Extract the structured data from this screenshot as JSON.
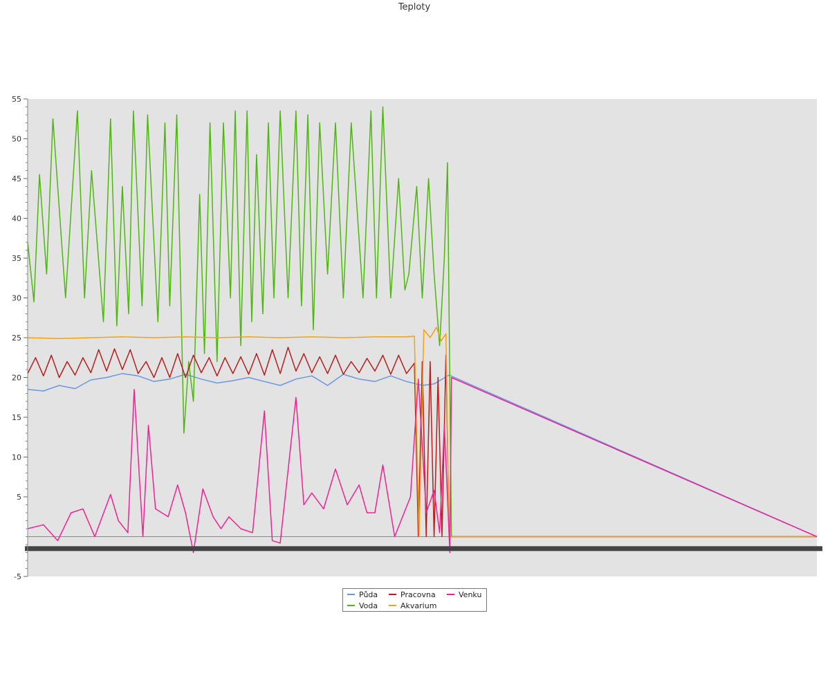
{
  "chart_data": {
    "type": "line",
    "title": "Teploty",
    "xlabel": "",
    "ylabel": "",
    "ylim": [
      -5,
      55
    ],
    "yticks": [
      -5,
      5,
      10,
      15,
      20,
      25,
      30,
      35,
      40,
      45,
      50,
      55
    ],
    "xlim": [
      0,
      100
    ],
    "grid": false,
    "legend_position": "bottom-center",
    "colors": {
      "plot_background": "#e3e3e3",
      "zero_line": "#888888",
      "x_axis_bar": "#444444"
    },
    "series": [
      {
        "name": "Půda",
        "color": "#6b96e2",
        "x": [
          0,
          2,
          4,
          6,
          8,
          10,
          12,
          14,
          16,
          18,
          20,
          22,
          24,
          26,
          28,
          30,
          32,
          34,
          36,
          38,
          40,
          42,
          44,
          46,
          48,
          50,
          51.5,
          53.4,
          100
        ],
        "values": [
          18.5,
          18.3,
          19.0,
          18.6,
          19.7,
          20.0,
          20.5,
          20.2,
          19.5,
          19.8,
          20.4,
          19.8,
          19.3,
          19.6,
          20.0,
          19.5,
          19.0,
          19.8,
          20.2,
          19.0,
          20.4,
          19.8,
          19.5,
          20.2,
          19.5,
          19.0,
          19.2,
          20.3,
          0
        ]
      },
      {
        "name": "Voda",
        "color": "#4cb70c",
        "x": [
          0,
          0.8,
          1.5,
          2.4,
          3.2,
          4.8,
          6.3,
          7.2,
          8.1,
          9.6,
          10.5,
          11.3,
          12.0,
          12.8,
          13.4,
          14.5,
          15.2,
          16.5,
          17.4,
          18.0,
          18.9,
          19.8,
          20.4,
          21.0,
          21.8,
          22.4,
          23.1,
          24.0,
          24.8,
          25.7,
          26.3,
          27.0,
          27.8,
          28.4,
          29.0,
          29.8,
          30.5,
          31.2,
          32.0,
          33.0,
          34.0,
          34.7,
          35.5,
          36.2,
          37.0,
          38.0,
          39.0,
          40.0,
          41.0,
          42.5,
          43.5,
          44.2,
          45.0,
          46.0,
          47.0,
          47.8,
          48.3,
          49.3,
          50.0,
          50.8,
          51.5,
          52.2,
          52.8,
          53.2,
          53.7,
          100
        ],
        "values": [
          37.0,
          29.5,
          45.5,
          33.0,
          52.5,
          30.0,
          53.5,
          30.0,
          46.0,
          27.0,
          52.5,
          26.5,
          44.0,
          28.0,
          53.5,
          29.0,
          53.0,
          27.0,
          52.0,
          29.0,
          53.0,
          13.0,
          22.0,
          17.0,
          43.0,
          23.0,
          52.0,
          22.0,
          52.0,
          30.0,
          53.5,
          24.0,
          53.5,
          27.0,
          48.0,
          28.0,
          52.0,
          30.0,
          53.5,
          30.0,
          53.5,
          29.0,
          53.0,
          26.0,
          52.0,
          33.0,
          52.0,
          30.0,
          52.0,
          30.0,
          53.5,
          30.0,
          54.0,
          30.0,
          45.0,
          31.0,
          33.0,
          44.0,
          30.0,
          45.0,
          33.0,
          24.0,
          35.0,
          47.0,
          0,
          0
        ]
      },
      {
        "name": "Pracovna",
        "color": "#b41e1e",
        "x": [
          0,
          1,
          2,
          3,
          4,
          5,
          6,
          7,
          8,
          9,
          10,
          11,
          12,
          13,
          14,
          15,
          16,
          17,
          18,
          19,
          20,
          21,
          22,
          23,
          24,
          25,
          26,
          27,
          28,
          29,
          30,
          31,
          32,
          33,
          34,
          35,
          36,
          37,
          38,
          39,
          40,
          41,
          42,
          43,
          44,
          45,
          46,
          47,
          48,
          49,
          49.5,
          50.0,
          50.5,
          51.0,
          51.5,
          52.0,
          52.5,
          53.0,
          53.4,
          100
        ],
        "values": [
          20.5,
          22.5,
          20.2,
          22.8,
          20.0,
          22.0,
          20.3,
          22.5,
          20.6,
          23.5,
          20.8,
          23.6,
          21.0,
          23.5,
          20.5,
          22.0,
          20.0,
          22.5,
          20.0,
          23.0,
          20.0,
          22.8,
          20.6,
          22.5,
          20.2,
          22.5,
          20.5,
          22.6,
          20.4,
          23.0,
          20.3,
          23.5,
          20.5,
          23.8,
          20.8,
          23.0,
          20.6,
          22.6,
          20.5,
          22.8,
          20.4,
          22.0,
          20.6,
          22.4,
          20.8,
          22.8,
          20.4,
          22.8,
          20.5,
          21.8,
          0,
          22.0,
          0,
          22.0,
          0,
          20.0,
          0,
          22.8,
          0,
          0
        ]
      },
      {
        "name": "Akvarium",
        "color": "#f2a11a",
        "x": [
          0,
          4,
          8,
          12,
          16,
          20,
          24,
          28,
          32,
          36,
          40,
          44,
          48,
          49.0,
          49.6,
          50.2,
          51.0,
          51.8,
          52.4,
          53.0,
          53.4,
          53.6,
          100
        ],
        "values": [
          25.0,
          24.9,
          25.0,
          25.1,
          25.0,
          25.1,
          25.0,
          25.1,
          25.0,
          25.1,
          25.0,
          25.1,
          25.1,
          25.2,
          0,
          26.0,
          25.0,
          26.3,
          24.6,
          25.5,
          0,
          0,
          0
        ]
      },
      {
        "name": "Venku",
        "color": "#ee2294",
        "x": [
          0,
          2.0,
          3.8,
          5.5,
          7.0,
          8.5,
          10.5,
          11.5,
          12.7,
          13.5,
          14.6,
          15.3,
          16.2,
          17.8,
          19.0,
          20.0,
          21.0,
          22.2,
          23.5,
          24.5,
          25.5,
          27.0,
          28.5,
          30.0,
          31.0,
          32.0,
          34.0,
          35.0,
          36.0,
          37.5,
          39.0,
          40.5,
          42.0,
          43.0,
          44.0,
          45.0,
          46.5,
          48.5,
          49.5,
          50.5,
          51.5,
          52.2,
          52.8,
          53.5,
          53.7,
          100
        ],
        "values": [
          1.0,
          1.5,
          -0.5,
          3.0,
          3.5,
          0.0,
          5.3,
          2.0,
          0.5,
          18.5,
          0.0,
          14.0,
          3.5,
          2.5,
          6.5,
          3.0,
          -2.0,
          6.0,
          2.5,
          1.0,
          2.5,
          1.0,
          0.5,
          15.8,
          -0.5,
          -0.8,
          17.5,
          4.0,
          5.5,
          3.5,
          8.5,
          4.0,
          6.5,
          3.0,
          3.0,
          9.0,
          0.0,
          5.0,
          19.8,
          3.0,
          5.8,
          0.5,
          14.0,
          -2.0,
          20.0,
          0
        ]
      }
    ]
  }
}
